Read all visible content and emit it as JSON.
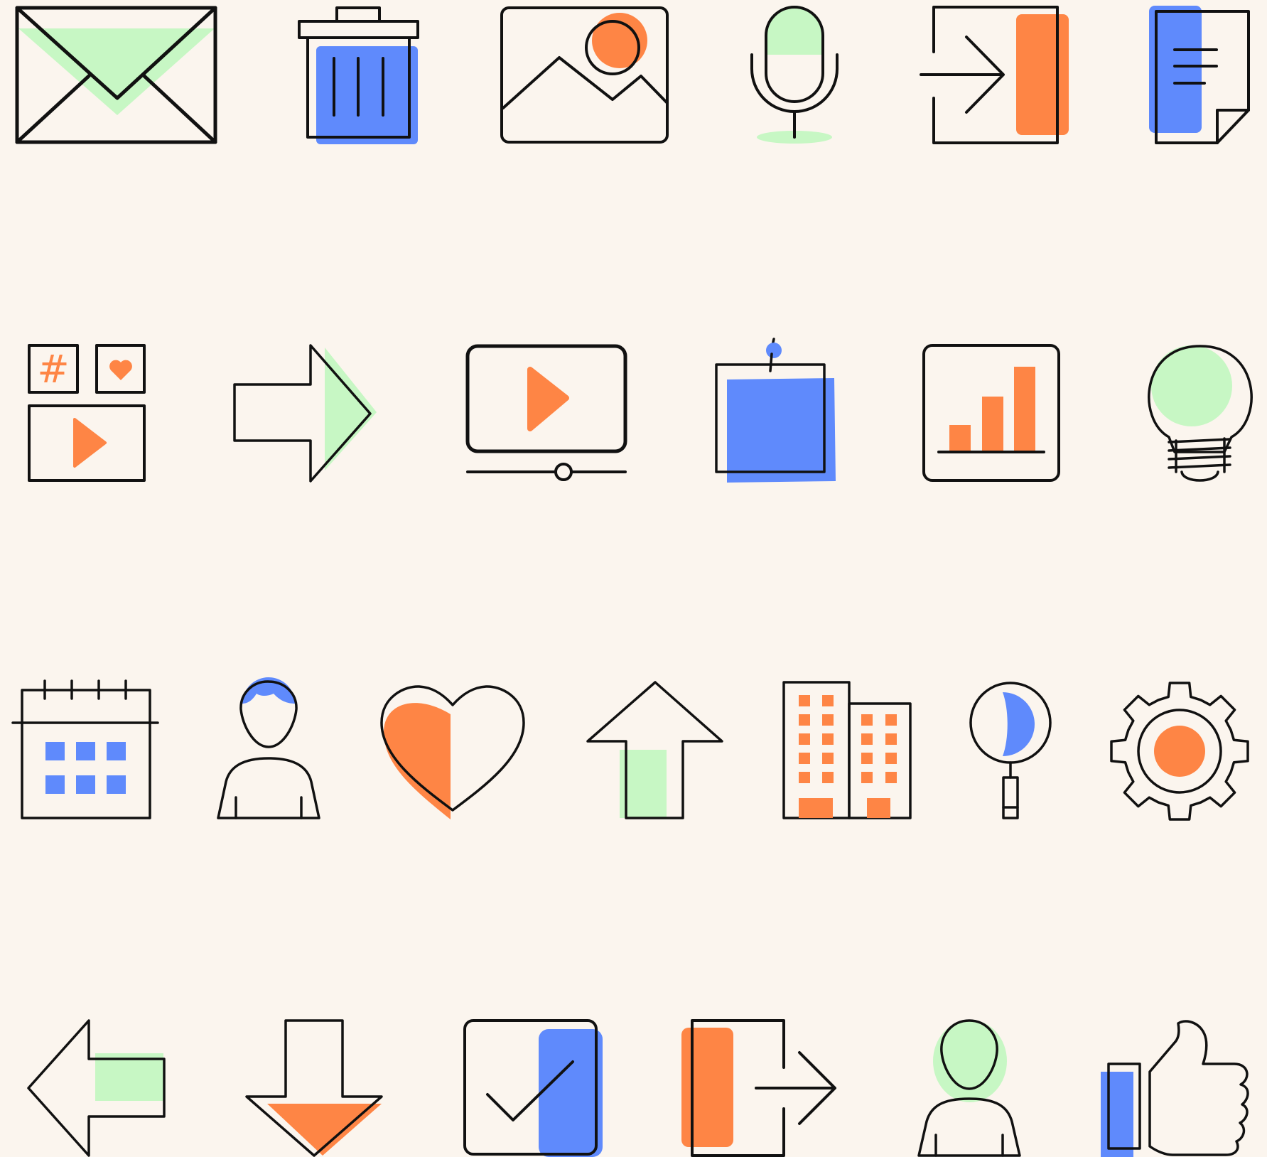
{
  "colors": {
    "background": "#fbf5ee",
    "outline": "#111111",
    "green": "#c7f7c4",
    "blue": "#5f8afc",
    "orange": "#fe8545"
  },
  "icons": [
    {
      "name": "envelope-icon"
    },
    {
      "name": "trash-icon"
    },
    {
      "name": "image-icon"
    },
    {
      "name": "microphone-icon"
    },
    {
      "name": "login-icon"
    },
    {
      "name": "document-icon"
    },
    {
      "name": "social-media-icon",
      "text": "#"
    },
    {
      "name": "arrow-right-icon"
    },
    {
      "name": "video-player-icon"
    },
    {
      "name": "sticky-note-icon"
    },
    {
      "name": "bar-chart-icon"
    },
    {
      "name": "lightbulb-icon"
    },
    {
      "name": "calendar-icon"
    },
    {
      "name": "user-male-icon"
    },
    {
      "name": "heart-icon"
    },
    {
      "name": "arrow-up-icon"
    },
    {
      "name": "buildings-icon"
    },
    {
      "name": "search-icon"
    },
    {
      "name": "gear-icon"
    },
    {
      "name": "arrow-left-icon"
    },
    {
      "name": "arrow-down-icon"
    },
    {
      "name": "checkbox-icon"
    },
    {
      "name": "logout-icon"
    },
    {
      "name": "user-female-icon"
    },
    {
      "name": "thumbs-up-icon"
    }
  ]
}
